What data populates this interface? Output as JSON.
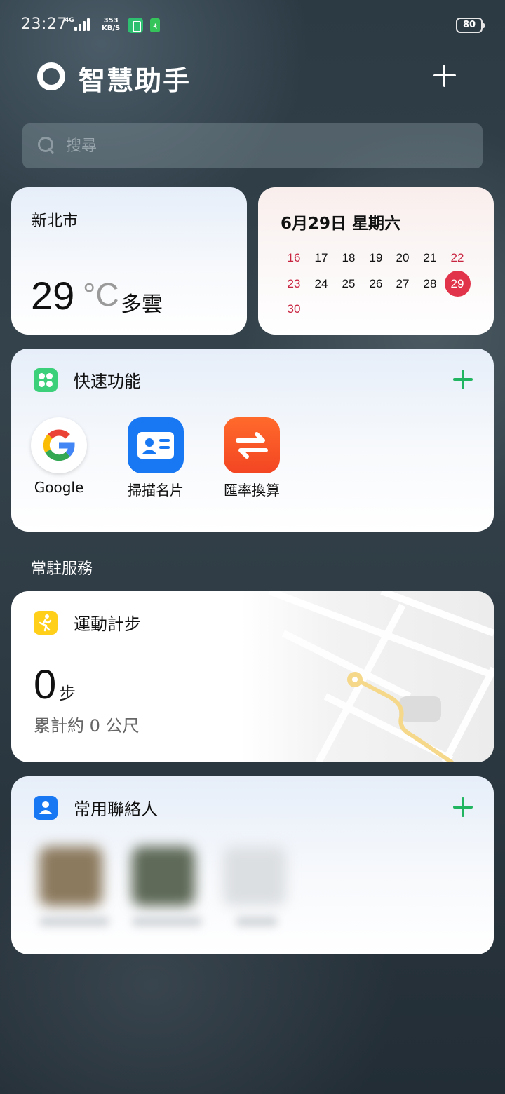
{
  "status_bar": {
    "time": "23:27",
    "network": "4G",
    "speed_value": "353",
    "speed_unit": "KB/S",
    "battery": "80"
  },
  "header": {
    "title": "智慧助手"
  },
  "search": {
    "placeholder": "搜尋"
  },
  "weather": {
    "city": "新北市",
    "temperature": "29",
    "unit": "°C",
    "condition": "多雲"
  },
  "calendar": {
    "title": "6月29日 星期六",
    "weeks": [
      [
        "16",
        "17",
        "18",
        "19",
        "20",
        "21",
        "22"
      ],
      [
        "23",
        "24",
        "25",
        "26",
        "27",
        "28",
        "29"
      ],
      [
        "30"
      ]
    ],
    "today": "29"
  },
  "quick_functions": {
    "title": "快速功能",
    "apps": [
      {
        "label": "Google",
        "icon": "google-icon"
      },
      {
        "label": "掃描名片",
        "icon": "business-card-icon"
      },
      {
        "label": "匯率換算",
        "icon": "exchange-icon"
      }
    ]
  },
  "resident_services": {
    "heading": "常駐服務"
  },
  "steps": {
    "title": "運動計步",
    "count": "0",
    "unit": "步",
    "distance": "累計約 0 公尺"
  },
  "contacts": {
    "title": "常用聯絡人"
  },
  "colors": {
    "accent_green": "#22b561",
    "calendar_red": "#c8233f",
    "today_circle": "#e1344a",
    "steps_yellow": "#ffcf1a",
    "blue": "#1877f2"
  }
}
